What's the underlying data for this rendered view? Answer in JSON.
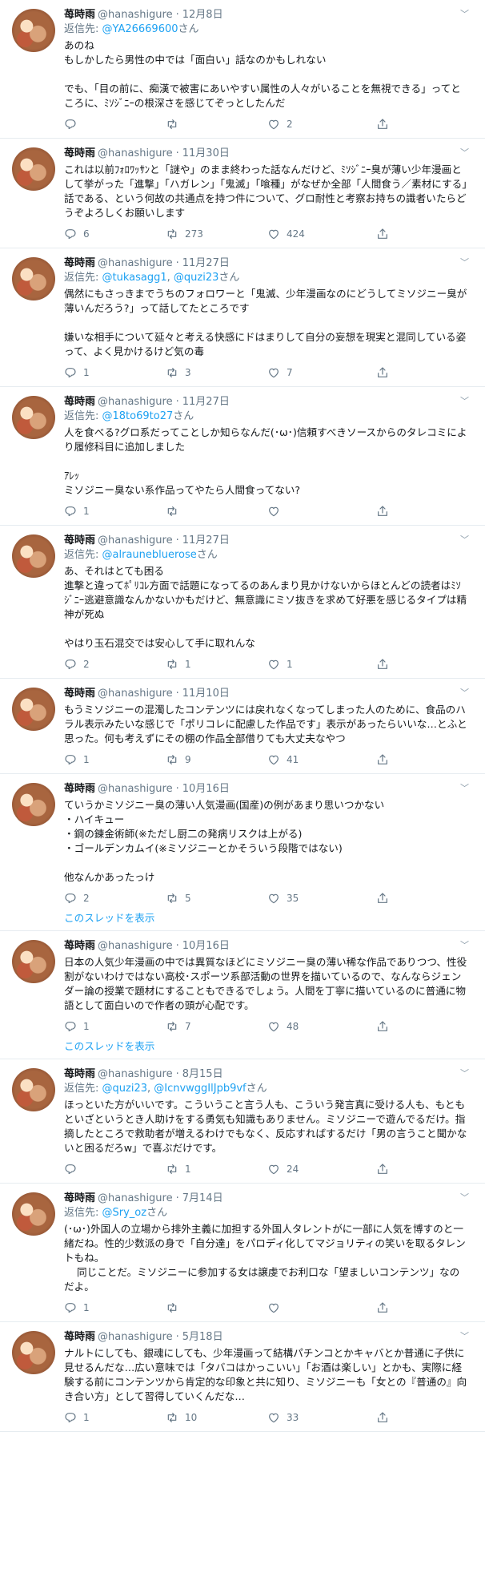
{
  "tweets": [
    {
      "name": "苺時雨",
      "handle": "@hanashigure",
      "date": "12月8日",
      "reply_prefix": "返信先: ",
      "reply_to": [
        "@YA26669600"
      ],
      "reply_suffix": "さん",
      "text": "あのね\nもしかしたら男性の中では「面白い」話なのかもしれない\n\nでも、「目の前に、痴漢で被害にあいやすい属性の人々がいることを無視できる」ってところに、ﾐｿｼﾞﾆｰの根深さを感じてぞっとしたんだ",
      "replies": "",
      "retweets": "",
      "likes": "2",
      "show_thread": ""
    },
    {
      "name": "苺時雨",
      "handle": "@hanashigure",
      "date": "11月30日",
      "reply_prefix": "",
      "reply_to": [],
      "reply_suffix": "",
      "text": "これは以前ﾌｫﾛﾜｯｻﾝと「謎や」のまま終わった話なんだけど、ﾐｿｼﾞﾆｰ臭が薄い少年漫画として挙がった「進撃」「ハガレン」「鬼滅」「喰種」がなぜか全部「人間食う／素材にする」話である、という何故の共通点を持つ件について、グロ耐性と考察お持ちの識者いたらどうぞよろしくお願いします",
      "replies": "6",
      "retweets": "273",
      "likes": "424",
      "show_thread": ""
    },
    {
      "name": "苺時雨",
      "handle": "@hanashigure",
      "date": "11月27日",
      "reply_prefix": "返信先: ",
      "reply_to": [
        "@tukasagg1",
        "@quzi23"
      ],
      "reply_suffix": "さん",
      "text": "偶然にもさっきまでうちのフォロワーと「鬼滅、少年漫画なのにどうしてミソジニー臭が薄いんだろう?」って話してたところです\n\n嫌いな相手について延々と考える快感にドはまりして自分の妄想を現実と混同している姿って、よく見かけるけど気の毒",
      "replies": "1",
      "retweets": "3",
      "likes": "7",
      "show_thread": ""
    },
    {
      "name": "苺時雨",
      "handle": "@hanashigure",
      "date": "11月27日",
      "reply_prefix": "返信先: ",
      "reply_to": [
        "@18to69to27"
      ],
      "reply_suffix": "さん",
      "text": "人を食べる?グロ系だってことしか知らなんだ(･ω･)信頼すべきソースからのタレコミにより履修科目に追加しました\n\nｱﾚｯ\nミソジニー臭ない系作品ってやたら人間食ってない?",
      "replies": "1",
      "retweets": "",
      "likes": "",
      "show_thread": ""
    },
    {
      "name": "苺時雨",
      "handle": "@hanashigure",
      "date": "11月27日",
      "reply_prefix": "返信先: ",
      "reply_to": [
        "@alraunebluerose"
      ],
      "reply_suffix": "さん",
      "text": "あ、それはとても困る\n進撃と違ってﾎﾟﾘｺﾚ方面で話題になってるのあんまり見かけないからほとんどの読者はﾐｿｼﾞﾆｰ逃避意識なんかないかもだけど、無意識にミソ抜きを求めて好悪を感じるタイプは精神が死ぬ\n\nやはり玉石混交では安心して手に取れんな",
      "replies": "2",
      "retweets": "1",
      "likes": "1",
      "show_thread": ""
    },
    {
      "name": "苺時雨",
      "handle": "@hanashigure",
      "date": "11月10日",
      "reply_prefix": "",
      "reply_to": [],
      "reply_suffix": "",
      "text": "もうミソジニーの混濁したコンテンツには戻れなくなってしまった人のために、食品のハラル表示みたいな感じで「ポリコレに配慮した作品です」表示があったらいいな…とふと思った。何も考えずにその棚の作品全部借りても大丈夫なやつ",
      "replies": "1",
      "retweets": "9",
      "likes": "41",
      "show_thread": ""
    },
    {
      "name": "苺時雨",
      "handle": "@hanashigure",
      "date": "10月16日",
      "reply_prefix": "",
      "reply_to": [],
      "reply_suffix": "",
      "text": "ていうかミソジニー臭の薄い人気漫画(国産)の例があまり思いつかない\n・ハイキュー\n・鋼の錬金術師(※ただし厨二の発病リスクは上がる)\n・ゴールデンカムイ(※ミソジニーとかそういう段階ではない)\n\n他なんかあったっけ",
      "replies": "2",
      "retweets": "5",
      "likes": "35",
      "show_thread": "このスレッドを表示"
    },
    {
      "name": "苺時雨",
      "handle": "@hanashigure",
      "date": "10月16日",
      "reply_prefix": "",
      "reply_to": [],
      "reply_suffix": "",
      "text": "日本の人気少年漫画の中では異質なほどにミソジニー臭の薄い稀な作品でありつつ、性役割がないわけではない高校･スポーツ系部活動の世界を描いているので、なんならジェンダー論の授業で題材にすることもできるでしょう。人間を丁寧に描いているのに普通に物語として面白いので作者の頭が心配です。",
      "replies": "1",
      "retweets": "7",
      "likes": "48",
      "show_thread": "このスレッドを表示"
    },
    {
      "name": "苺時雨",
      "handle": "@hanashigure",
      "date": "8月15日",
      "reply_prefix": "返信先: ",
      "reply_to": [
        "@quzi23",
        "@IcnvwggIlJpb9vf"
      ],
      "reply_suffix": "さん",
      "text": "ほっといた方がいいです。こういうこと言う人も、こういう発言真に受ける人も、もともといざというとき人助けをする勇気も知識もありません。ミソジニーで遊んでるだけ。指摘したところで救助者が増えるわけでもなく、反応すればするだけ「男の言うこと聞かないと困るだろw」で喜ぶだけです。",
      "replies": "",
      "retweets": "1",
      "likes": "24",
      "show_thread": ""
    },
    {
      "name": "苺時雨",
      "handle": "@hanashigure",
      "date": "7月14日",
      "reply_prefix": "返信先: ",
      "reply_to": [
        "@Sry_oz"
      ],
      "reply_suffix": "さん",
      "text": "(･ω･)外国人の立場から排外主義に加担する外国人タレントがに一部に人気を博すのと一緒だね。性的少数派の身で「自分達」をパロディ化してマジョリティの笑いを取るタレントもね。\n    同じことだ。ミソジニーに参加する女は譲虔でお利口な「望ましいコンテンツ」なのだよ。",
      "replies": "1",
      "retweets": "",
      "likes": "",
      "show_thread": ""
    },
    {
      "name": "苺時雨",
      "handle": "@hanashigure",
      "date": "5月18日",
      "reply_prefix": "",
      "reply_to": [],
      "reply_suffix": "",
      "text": "ナルトにしても、銀魂にしても、少年漫画って結構パチンコとかキャバとか普通に子供に見せるんだな…広い意味では「タバコはかっこいい」「お酒は楽しい」とかも、実際に経験する前にコンテンツから肯定的な印象と共に知り、ミソジニーも「女との『普通の』向き合い方」として習得していくんだな…",
      "replies": "1",
      "retweets": "10",
      "likes": "33",
      "show_thread": ""
    }
  ]
}
